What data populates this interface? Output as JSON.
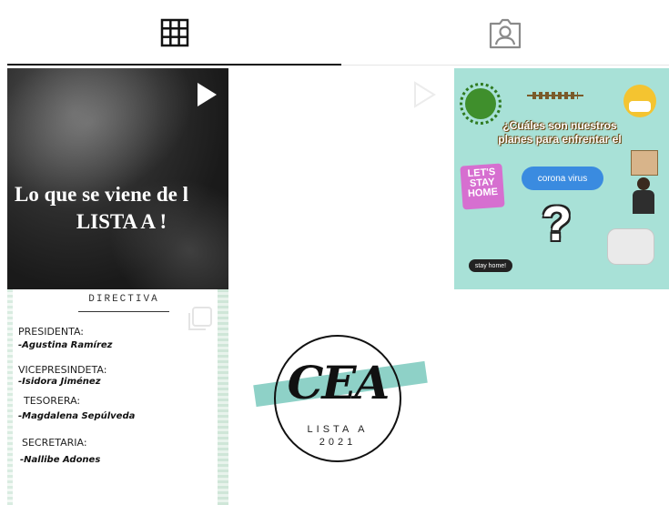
{
  "tabs": [
    {
      "icon": "grid-icon",
      "active": true
    },
    {
      "icon": "tagged-icon",
      "active": false
    }
  ],
  "posts": [
    {
      "type": "video",
      "overlay_text": [
        "Lo que se viene de l",
        "LISTA A !"
      ]
    },
    {
      "type": "video",
      "overlay_text": []
    },
    {
      "type": "image",
      "heading": "¿Cuáles son nuestros planes para enfrentar el",
      "bubble": "corona virus",
      "sticker": "LET'S STAY HOME",
      "pill": "stay home!",
      "symbol": "?"
    },
    {
      "type": "image",
      "heading": "DIRECTIVA",
      "roles": [
        {
          "label": "PRESIDENTA:",
          "name": "-Agustina Ramírez"
        },
        {
          "label": "VICEPRESINDETA:",
          "name": "-Isidora Jiménez"
        },
        {
          "label": "TESORERA:",
          "name": "-Magdalena Sepúlveda"
        },
        {
          "label": "SECRETARIA:",
          "name": "-Nallibe Adones"
        }
      ]
    },
    {
      "type": "image",
      "logo": "CEA",
      "line1": "LISTA A",
      "line2": "2021"
    }
  ],
  "colors": {
    "accent_teal": "#8ed1c7",
    "tile3_bg": "#a8e1d7",
    "active_tab": "#111111"
  }
}
